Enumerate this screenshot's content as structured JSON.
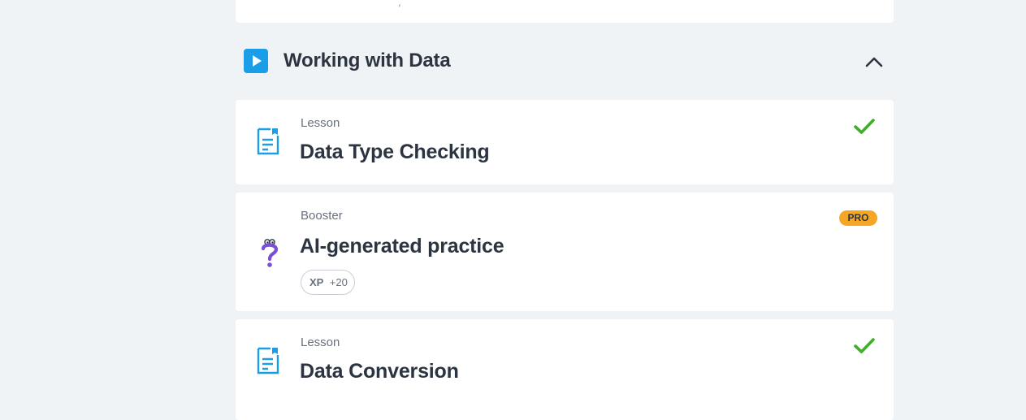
{
  "previous_card": {
    "snippet": ","
  },
  "section": {
    "title": "Working with Data",
    "icon": "play-icon",
    "toggle_icon": "chevron-up-icon",
    "accent": "#1b9ee8"
  },
  "items": [
    {
      "type": "Lesson",
      "title": "Data Type Checking",
      "icon": "document-icon",
      "status": "completed"
    },
    {
      "type": "Booster",
      "title": "AI-generated practice",
      "icon": "question-mark-icon",
      "badge": "PRO",
      "xp_label": "XP",
      "xp_value": "+20"
    },
    {
      "type": "Lesson",
      "title": "Data Conversion",
      "icon": "document-icon",
      "status": "completed"
    }
  ],
  "colors": {
    "background": "#eff3f6",
    "check": "#3fae2a",
    "pro_badge": "#f5a623",
    "booster_icon": "#7b4fd6"
  }
}
